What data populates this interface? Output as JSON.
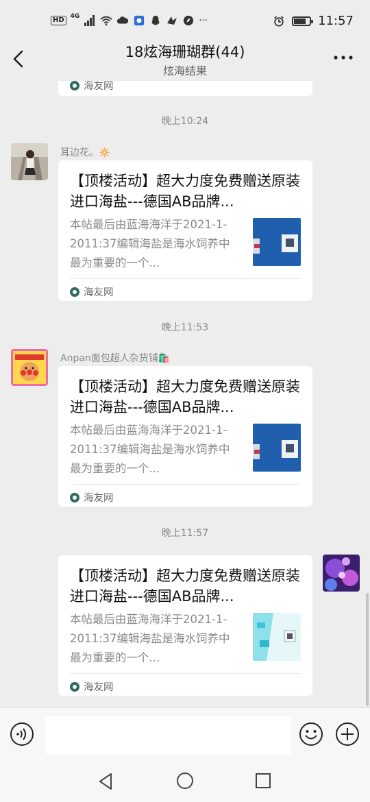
{
  "status_bar": {
    "hd": "HD",
    "network": "4G",
    "more": "···",
    "time": "11:57"
  },
  "header": {
    "title": "18炫海珊瑚群(44)",
    "subtitle": "炫海结果"
  },
  "messages": [
    {
      "time": "晚上10:24",
      "sender": "耳边花。🔅",
      "card": {
        "title": "【顶楼活动】超大力度免费赠送原装进口海盐---德国AB品牌...",
        "description": "本帖最后由蓝海海洋于2021-1-2011:37编辑海盐是海水饲养中最为重要的一个...",
        "source": "海友网"
      }
    },
    {
      "time": "晚上11:53",
      "sender": "Anpan面包超人杂货铺🛍️",
      "card": {
        "title": "【顶楼活动】超大力度免费赠送原装进口海盐---德国AB品牌...",
        "description": "本帖最后由蓝海海洋于2021-1-2011:37编辑海盐是海水饲养中最为重要的一个...",
        "source": "海友网"
      }
    },
    {
      "time": "晚上11:57",
      "sender": "",
      "card": {
        "title": "【顶楼活动】超大力度免费赠送原装进口海盐---德国AB品牌...",
        "description": "本帖最后由蓝海海洋于2021-1-2011:37编辑海盐是海水饲养中最为重要的一个...",
        "source": "海友网"
      }
    }
  ],
  "previous_card": {
    "source": "海友网"
  },
  "input": {
    "placeholder": ""
  }
}
